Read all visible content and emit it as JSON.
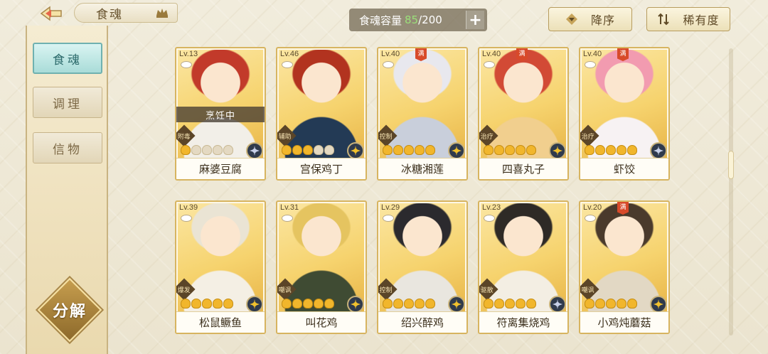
{
  "header": {
    "title": "食魂",
    "capacity_label": "食魂容量",
    "capacity_current": "85",
    "capacity_max": "/200",
    "plus_label": "+",
    "sort_order_label": "降序",
    "sort_by_label": "稀有度"
  },
  "sidebar": {
    "tabs": [
      {
        "label": "食魂",
        "active": true
      },
      {
        "label": "调理",
        "active": false
      },
      {
        "label": "信物",
        "active": false
      }
    ],
    "decompose_label": "分解"
  },
  "cards": [
    {
      "level": "Lv.13",
      "name": "麻婆豆腐",
      "role": "附毒",
      "stars": 1,
      "status": "烹饪中",
      "full": false,
      "element_color": "#c7d0e8",
      "palette": [
        "#f6d36e",
        "#c23a2a",
        "#f2efe8"
      ]
    },
    {
      "level": "Lv.46",
      "name": "宫保鸡丁",
      "role": "辅助",
      "stars": 3,
      "status": "",
      "full": false,
      "element_color": "#f1c12e",
      "palette": [
        "#f6d36e",
        "#b2331f",
        "#233a55"
      ]
    },
    {
      "level": "Lv.40",
      "name": "冰糖湘莲",
      "role": "控制",
      "stars": 5,
      "status": "",
      "full": true,
      "element_color": "#f1c12e",
      "palette": [
        "#f6d36e",
        "#e8e8ee",
        "#c9cfdb"
      ]
    },
    {
      "level": "Lv.40",
      "name": "四喜丸子",
      "role": "治疗",
      "stars": 5,
      "status": "",
      "full": true,
      "element_color": "#f1c12e",
      "palette": [
        "#f6d36e",
        "#d24a35",
        "#f1cf8e"
      ]
    },
    {
      "level": "Lv.40",
      "name": "虾饺",
      "role": "治疗",
      "stars": 5,
      "status": "",
      "full": true,
      "element_color": "#c7d0e8",
      "palette": [
        "#f6d36e",
        "#f29bb0",
        "#f7f2f3"
      ]
    },
    {
      "level": "Lv.39",
      "name": "松鼠鳜鱼",
      "role": "爆发",
      "stars": 5,
      "status": "",
      "full": false,
      "element_color": "#f1c12e",
      "palette": [
        "#f6d36e",
        "#eae4d4",
        "#f4efe4"
      ]
    },
    {
      "level": "Lv.31",
      "name": "叫花鸡",
      "role": "嘲讽",
      "stars": 5,
      "status": "",
      "full": false,
      "element_color": "#f1c12e",
      "palette": [
        "#f6d36e",
        "#e5c460",
        "#3f4b33"
      ]
    },
    {
      "level": "Lv.29",
      "name": "绍兴醉鸡",
      "role": "控制",
      "stars": 5,
      "status": "",
      "full": false,
      "element_color": "#f1c12e",
      "palette": [
        "#f6d36e",
        "#2b2a2e",
        "#e9e6df"
      ]
    },
    {
      "level": "Lv.23",
      "name": "符离集烧鸡",
      "role": "驱散",
      "stars": 5,
      "status": "",
      "full": false,
      "element_color": "#c7d0e8",
      "palette": [
        "#f6d36e",
        "#2e2a26",
        "#f3eee3"
      ]
    },
    {
      "level": "Lv.20",
      "name": "小鸡炖蘑菇",
      "role": "嘲讽",
      "stars": 5,
      "status": "",
      "full": true,
      "element_color": "#f1c12e",
      "palette": [
        "#f6d36e",
        "#4a3a2c",
        "#e2d8c4"
      ]
    }
  ],
  "colors": {
    "accent_gold": "#d7b460",
    "active_tab": "#a9dcd8",
    "capacity_green": "#9be07a"
  }
}
